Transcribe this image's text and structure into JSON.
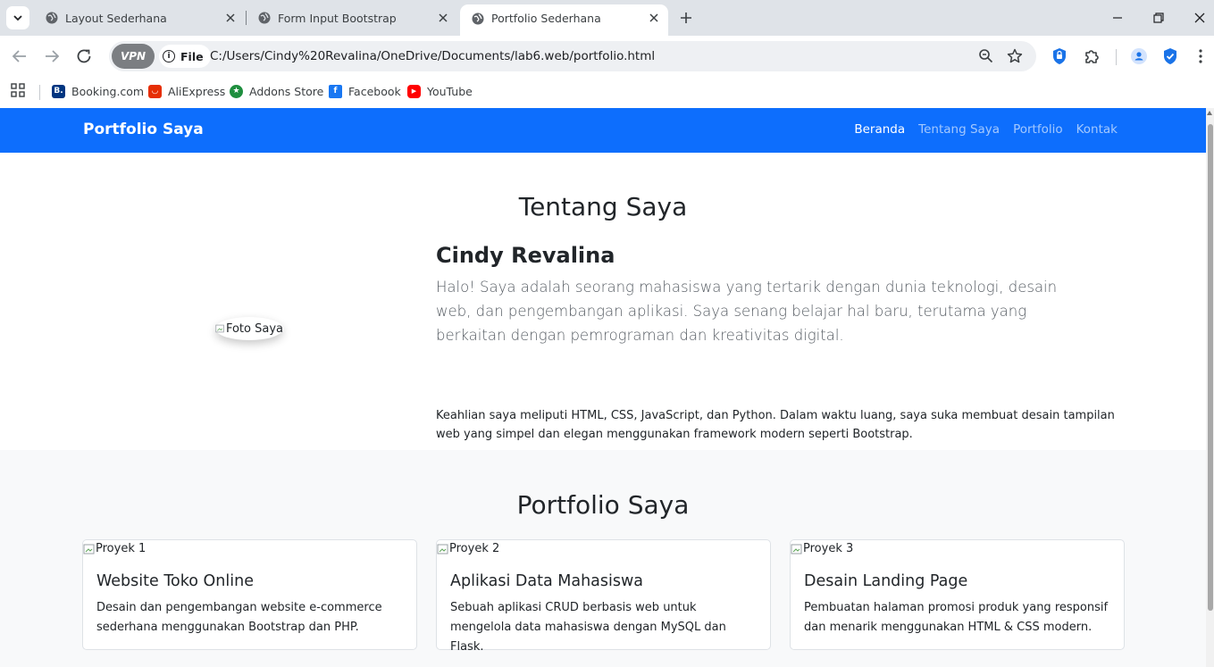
{
  "browser": {
    "tabs": [
      {
        "title": "Layout Sederhana",
        "active": false
      },
      {
        "title": "Form Input Bootstrap",
        "active": false
      },
      {
        "title": "Portfolio Sederhana",
        "active": true
      }
    ],
    "vpn_label": "VPN",
    "file_label": "File",
    "url": "C:/Users/Cindy%20Revalina/OneDrive/Documents/lab6.web/portfolio.html",
    "bookmarks": [
      {
        "label": "Booking.com",
        "icon": "booking-icon",
        "color": "#003580"
      },
      {
        "label": "AliExpress",
        "icon": "aliexpress-icon",
        "color": "#e62e04"
      },
      {
        "label": "Addons Store",
        "icon": "addons-store-icon",
        "color": "#1e8e3e"
      },
      {
        "label": "Facebook",
        "icon": "facebook-icon",
        "color": "#1877f2"
      },
      {
        "label": "YouTube",
        "icon": "youtube-icon",
        "color": "#ff0000"
      }
    ]
  },
  "page": {
    "navbar": {
      "brand": "Portfolio Saya",
      "links": [
        {
          "label": "Beranda",
          "active": true
        },
        {
          "label": "Tentang Saya",
          "active": false
        },
        {
          "label": "Portfolio",
          "active": false
        },
        {
          "label": "Kontak",
          "active": false
        }
      ],
      "color": "#0d6efd"
    },
    "about": {
      "title": "Tentang Saya",
      "photo_alt": "Foto Saya",
      "name": "Cindy Revalina",
      "lead": "Halo! Saya adalah seorang mahasiswa yang tertarik dengan dunia teknologi, desain web, dan pengembangan aplikasi. Saya senang belajar hal baru, terutama yang berkaitan dengan pemrograman dan kreativitas digital.",
      "description": "Keahlian saya meliputi HTML, CSS, JavaScript, dan Python. Dalam waktu luang, saya suka membuat desain tampilan web yang simpel dan elegan menggunakan framework modern seperti Bootstrap."
    },
    "portfolio": {
      "title": "Portfolio Saya",
      "cards": [
        {
          "img_alt": "Proyek 1",
          "title": "Website Toko Online",
          "text": "Desain dan pengembangan website e-commerce sederhana menggunakan Bootstrap dan PHP."
        },
        {
          "img_alt": "Proyek 2",
          "title": "Aplikasi Data Mahasiswa",
          "text": "Sebuah aplikasi CRUD berbasis web untuk mengelola data mahasiswa dengan MySQL dan Flask."
        },
        {
          "img_alt": "Proyek 3",
          "title": "Desain Landing Page",
          "text": "Pembuatan halaman promosi produk yang responsif dan menarik menggunakan HTML & CSS modern."
        }
      ]
    }
  }
}
